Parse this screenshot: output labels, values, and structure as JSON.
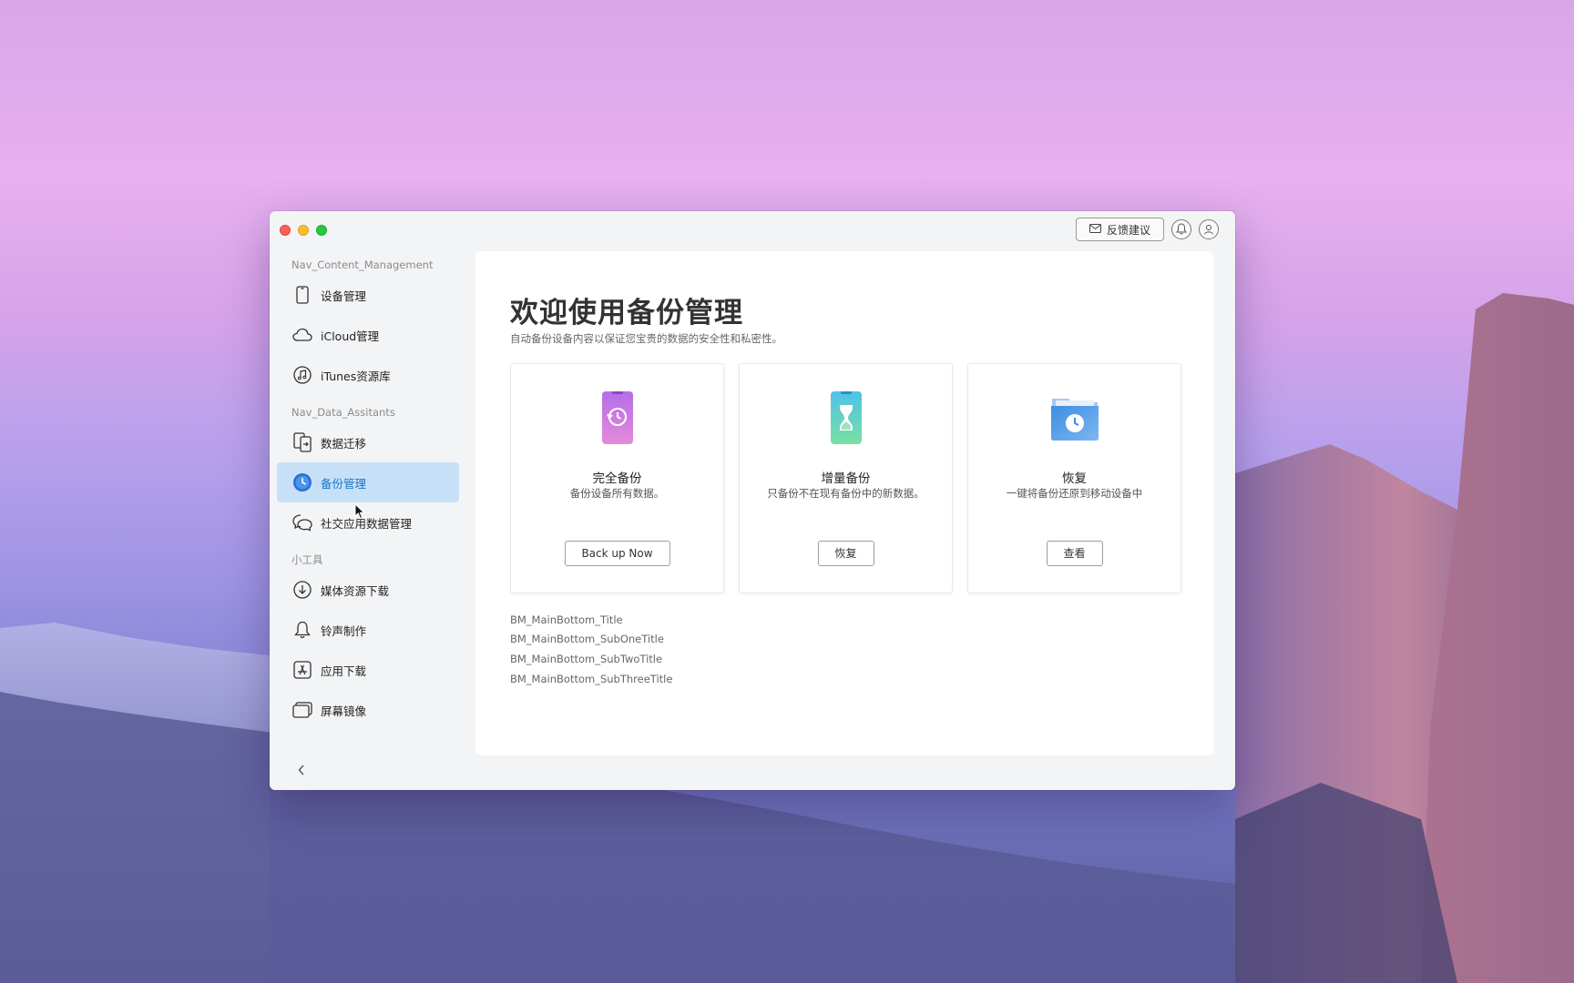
{
  "window": {
    "topbar": {
      "feedback_label": "反馈建议",
      "icons": [
        "mail-icon",
        "bell-icon",
        "user-icon"
      ]
    }
  },
  "sidebar": {
    "sections": [
      {
        "title": "Nav_Content_Management",
        "items": [
          {
            "label": "设备管理",
            "icon": "phone-icon",
            "active": false
          },
          {
            "label": "iCloud管理",
            "icon": "cloud-icon",
            "active": false
          },
          {
            "label": "iTunes资源库",
            "icon": "music-icon",
            "active": false
          }
        ]
      },
      {
        "title": "Nav_Data_Assitants",
        "items": [
          {
            "label": "数据迁移",
            "icon": "transfer-icon",
            "active": false
          },
          {
            "label": "备份管理",
            "icon": "backup-icon",
            "active": true
          },
          {
            "label": "社交应用数据管理",
            "icon": "chat-icon",
            "active": false
          }
        ]
      },
      {
        "title": "小工具",
        "items": [
          {
            "label": "媒体资源下载",
            "icon": "download-icon",
            "active": false
          },
          {
            "label": "铃声制作",
            "icon": "bell-icon",
            "active": false
          },
          {
            "label": "应用下载",
            "icon": "app-store-icon",
            "active": false
          },
          {
            "label": "屏幕镜像",
            "icon": "mirror-icon",
            "active": false
          }
        ]
      }
    ]
  },
  "main": {
    "title": "欢迎使用备份管理",
    "subtitle": "自动备份设备内容以保证您宝贵的数据的安全性和私密性。",
    "cards": [
      {
        "title": "完全备份",
        "desc": "备份设备所有数据。",
        "button": "Back up Now",
        "icon": "full-backup-icon"
      },
      {
        "title": "增量备份",
        "desc": "只备份不在现有备份中的新数据。",
        "button": "恢复",
        "icon": "incremental-backup-icon"
      },
      {
        "title": "恢复",
        "desc": "一键将备份还原到移动设备中",
        "button": "查看",
        "icon": "restore-folder-icon"
      }
    ],
    "bottom": {
      "title": "BM_MainBottom_Title",
      "sub_one": "BM_MainBottom_SubOneTitle",
      "sub_two": "BM_MainBottom_SubTwoTitle",
      "sub_three": "BM_MainBottom_SubThreeTitle"
    }
  },
  "colors": {
    "active_bg": "#c6e1f7",
    "active_text": "#1c74c8",
    "close": "#fe5f57",
    "minimize": "#febc2e",
    "maximize": "#28c840"
  }
}
